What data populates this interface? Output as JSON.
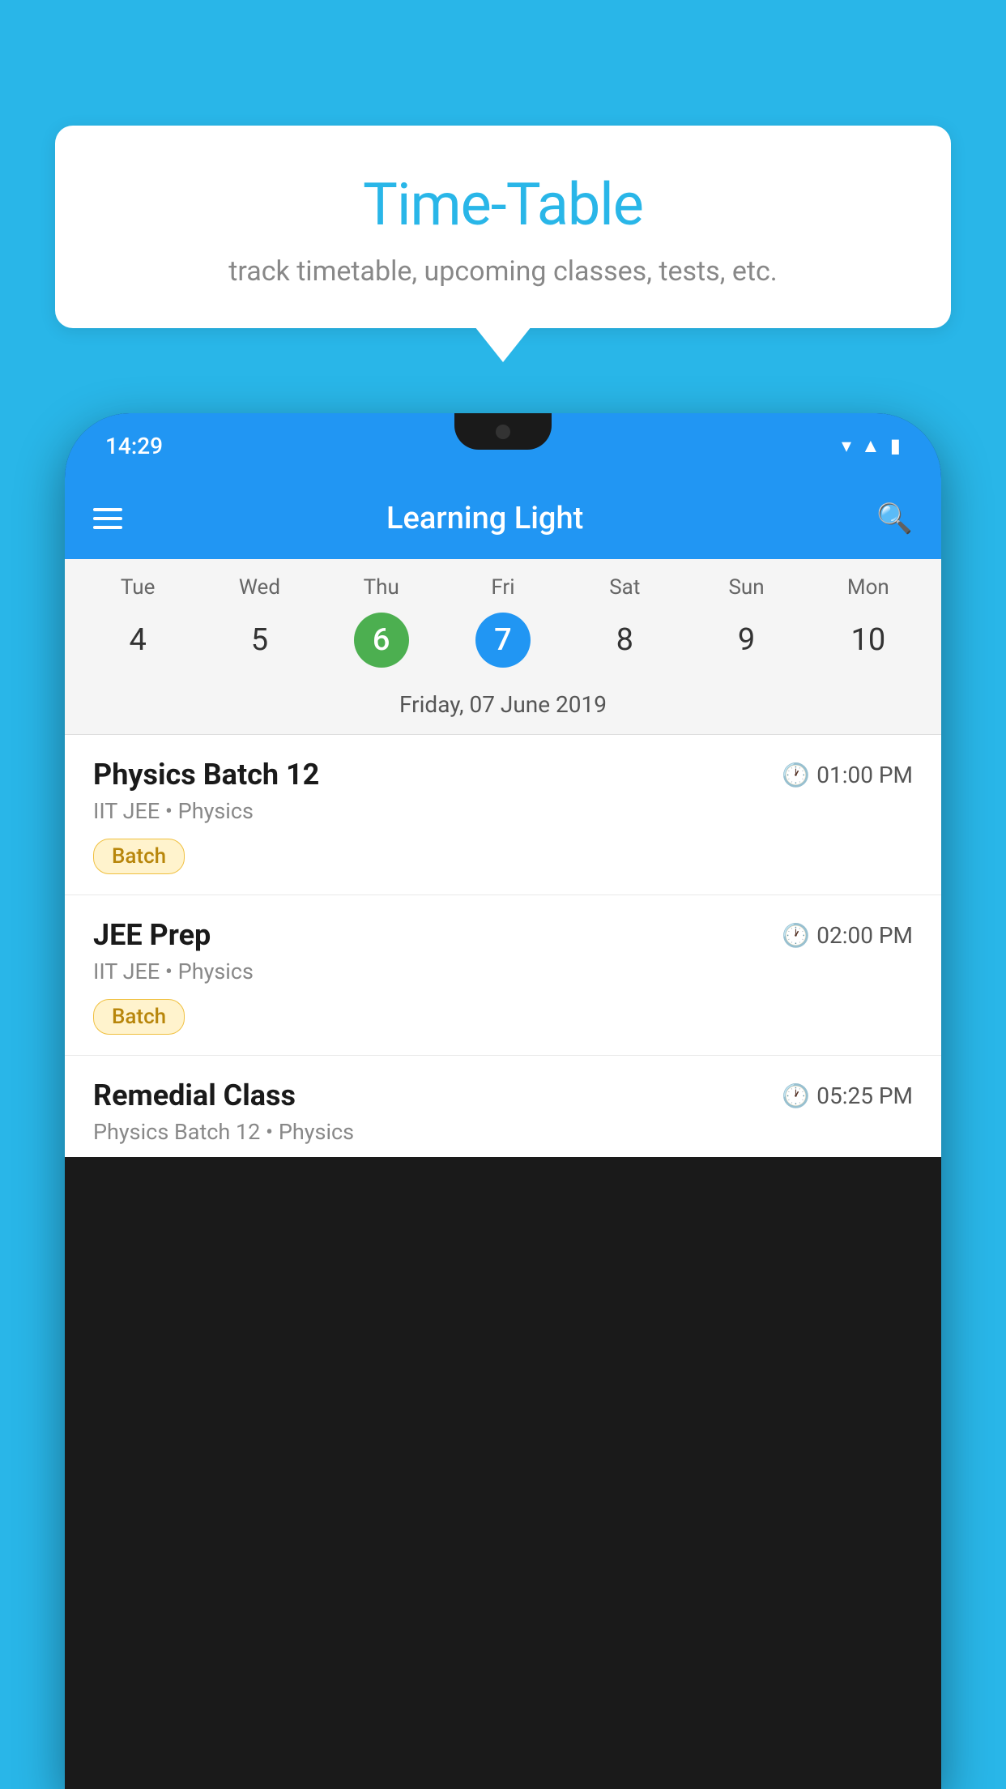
{
  "background_color": "#29B6E8",
  "speech_bubble": {
    "title": "Time-Table",
    "subtitle": "track timetable, upcoming classes, tests, etc."
  },
  "phone": {
    "status_bar": {
      "time": "14:29"
    },
    "app_bar": {
      "title": "Learning Light"
    },
    "calendar": {
      "days": [
        "Tue",
        "Wed",
        "Thu",
        "Fri",
        "Sat",
        "Sun",
        "Mon"
      ],
      "dates": [
        "4",
        "5",
        "6",
        "7",
        "8",
        "9",
        "10"
      ],
      "today_index": 2,
      "selected_index": 3,
      "selected_date_label": "Friday, 07 June 2019"
    },
    "classes": [
      {
        "title": "Physics Batch 12",
        "time": "01:00 PM",
        "subtitle": "IIT JEE • Physics",
        "badge": "Batch"
      },
      {
        "title": "JEE Prep",
        "time": "02:00 PM",
        "subtitle": "IIT JEE • Physics",
        "badge": "Batch"
      },
      {
        "title": "Remedial Class",
        "time": "05:25 PM",
        "subtitle": "Physics Batch 12 • Physics",
        "badge": null
      }
    ]
  }
}
